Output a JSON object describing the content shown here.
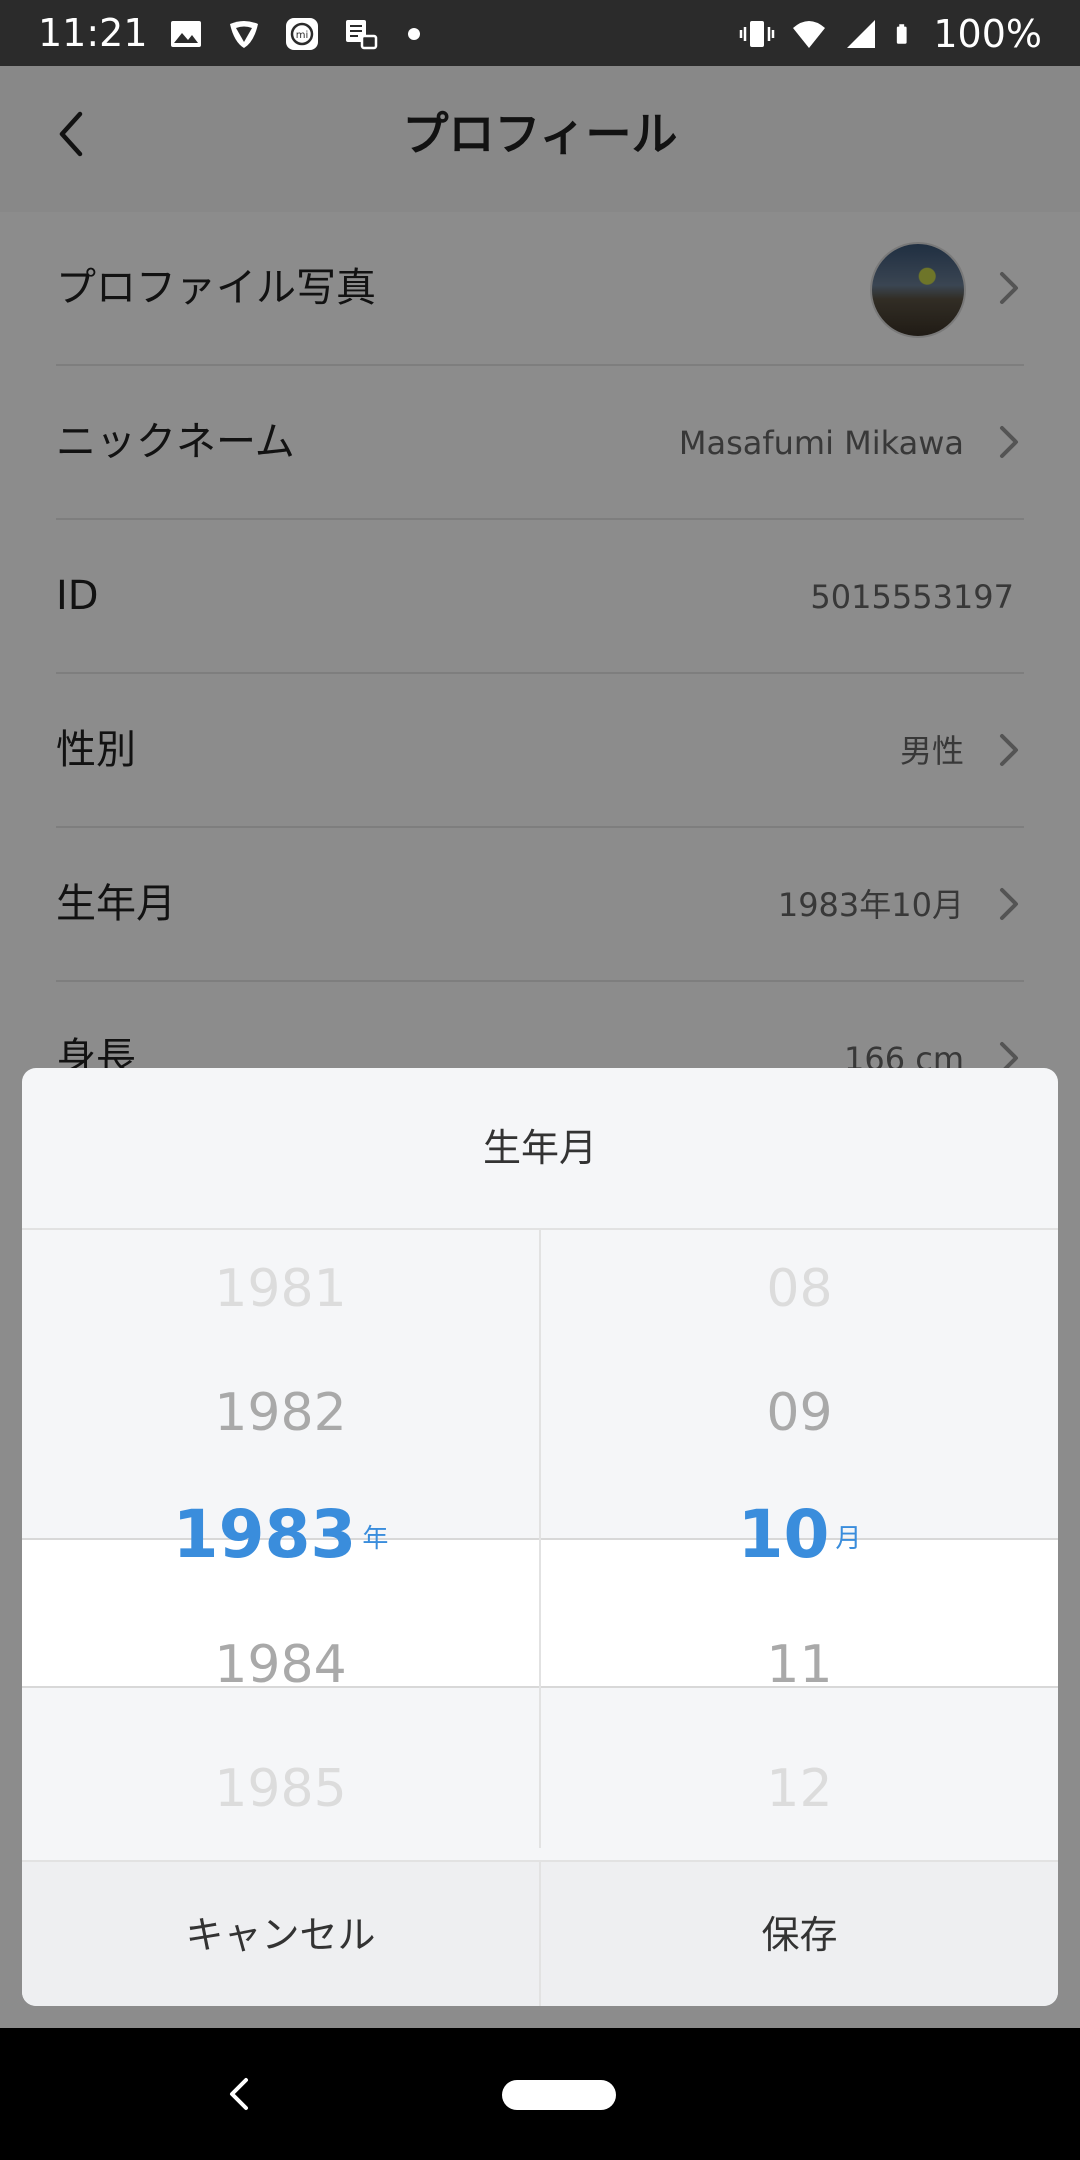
{
  "status_bar": {
    "time": "11:21",
    "battery": "100%",
    "icons_left": [
      "gallery-icon",
      "shield-app-icon",
      "mi-icon",
      "tasks-icon",
      "dot-icon"
    ],
    "icons_right": [
      "vibrate-icon",
      "wifi-icon",
      "signal-icon",
      "battery-icon"
    ]
  },
  "header": {
    "title": "プロフィール"
  },
  "profile": {
    "rows": [
      {
        "label": "プロファイル写真",
        "value": "",
        "type": "avatar"
      },
      {
        "label": "ニックネーム",
        "value": "Masafumi Mikawa"
      },
      {
        "label": "ID",
        "value": "5015553197"
      },
      {
        "label": "性別",
        "value": "男性"
      },
      {
        "label": "生年月",
        "value": "1983年10月"
      },
      {
        "label": "身長",
        "value": "166 cm"
      }
    ]
  },
  "dialog": {
    "title": "生年月",
    "years": [
      "1981",
      "1982",
      "1983",
      "1984",
      "1985"
    ],
    "year_unit": "年",
    "months": [
      "08",
      "09",
      "10",
      "11",
      "12"
    ],
    "month_unit": "月",
    "selected_year": "1983",
    "selected_month": "10",
    "cancel_label": "キャンセル",
    "save_label": "保存"
  },
  "colors": {
    "accent": "#3a8ddc",
    "statusbar": "#2b2b2b",
    "navbar": "#000000"
  }
}
